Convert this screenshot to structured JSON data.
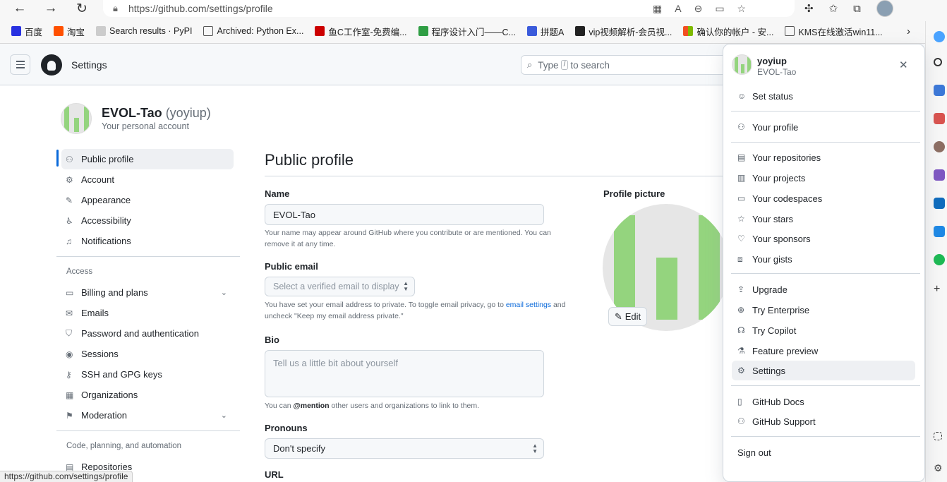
{
  "browser": {
    "url": "https://github.com/settings/profile",
    "bookmarks": [
      {
        "label": "百度",
        "color": "#2932e1"
      },
      {
        "label": "淘宝",
        "color": "#ff5000"
      },
      {
        "label": "Search results · PyPI",
        "color": "#cccccc"
      },
      {
        "label": "Archived: Python Ex...",
        "color": "#ffffff"
      },
      {
        "label": "鱼C工作室-免费编...",
        "color": "#cc0000"
      },
      {
        "label": "程序设计入门——C...",
        "color": "#2f9e44"
      },
      {
        "label": "拼题A",
        "color": "#3b5bdb"
      },
      {
        "label": "vip视频解析-会员视...",
        "color": "#222222"
      },
      {
        "label": "确认你的帐户 - 安...",
        "color": "#f25022"
      },
      {
        "label": "KMS在线激活win11...",
        "color": "#ffffff"
      }
    ]
  },
  "header": {
    "title": "Settings",
    "search_prefix": "Type",
    "search_key": "/",
    "search_suffix": "to search"
  },
  "account": {
    "display_name": "EVOL-Tao",
    "login": "(yoyiup)",
    "subtitle": "Your personal account"
  },
  "sidebar": {
    "items": [
      {
        "label": "Public profile",
        "icon": "person-icon"
      },
      {
        "label": "Account",
        "icon": "gear-icon"
      },
      {
        "label": "Appearance",
        "icon": "paintbrush-icon"
      },
      {
        "label": "Accessibility",
        "icon": "accessibility-icon"
      },
      {
        "label": "Notifications",
        "icon": "bell-icon"
      }
    ],
    "group_access": "Access",
    "access_items": [
      {
        "label": "Billing and plans",
        "icon": "credit-card-icon"
      },
      {
        "label": "Emails",
        "icon": "mail-icon"
      },
      {
        "label": "Password and authentication",
        "icon": "shield-lock-icon"
      },
      {
        "label": "Sessions",
        "icon": "broadcast-icon"
      },
      {
        "label": "SSH and GPG keys",
        "icon": "key-icon"
      },
      {
        "label": "Organizations",
        "icon": "organization-icon"
      },
      {
        "label": "Moderation",
        "icon": "report-icon"
      }
    ],
    "group_code": "Code, planning, and automation",
    "code_items": [
      {
        "label": "Repositories",
        "icon": "repo-icon"
      }
    ]
  },
  "main": {
    "title": "Public profile",
    "name_label": "Name",
    "name_value": "EVOL-Tao",
    "name_note": "Your name may appear around GitHub where you contribute or are mentioned. You can remove it at any time.",
    "email_label": "Public email",
    "email_placeholder": "Select a verified email to display",
    "email_note_1": "You have set your email address to private. To toggle email privacy, go to",
    "email_note_link": "email settings",
    "email_note_2": "and uncheck \"Keep my email address private.\"",
    "bio_label": "Bio",
    "bio_placeholder": "Tell us a little bit about yourself",
    "bio_note_1": "You can",
    "bio_note_mention": "@mention",
    "bio_note_2": "other users and organizations to link to them.",
    "pronouns_label": "Pronouns",
    "pronouns_value": "Don't specify",
    "url_label": "URL",
    "picture_label": "Profile picture",
    "edit_label": "Edit"
  },
  "menu": {
    "username": "yoyiup",
    "fullname": "EVOL-Tao",
    "items": [
      {
        "label": "Set status",
        "icon": "smiley-icon"
      },
      {
        "label": "Your profile",
        "icon": "person-icon"
      },
      {
        "label": "Your repositories",
        "icon": "repo-icon"
      },
      {
        "label": "Your projects",
        "icon": "table-icon"
      },
      {
        "label": "Your codespaces",
        "icon": "codespaces-icon"
      },
      {
        "label": "Your stars",
        "icon": "star-icon"
      },
      {
        "label": "Your sponsors",
        "icon": "heart-icon"
      },
      {
        "label": "Your gists",
        "icon": "code-square-icon"
      },
      {
        "label": "Upgrade",
        "icon": "upload-icon"
      },
      {
        "label": "Try Enterprise",
        "icon": "globe-icon"
      },
      {
        "label": "Try Copilot",
        "icon": "copilot-icon"
      },
      {
        "label": "Feature preview",
        "icon": "beaker-icon"
      },
      {
        "label": "Settings",
        "icon": "gear-icon"
      },
      {
        "label": "GitHub Docs",
        "icon": "book-icon"
      },
      {
        "label": "GitHub Support",
        "icon": "people-icon"
      },
      {
        "label": "Sign out",
        "icon": ""
      }
    ]
  },
  "status_bar": {
    "hover_url": "https://github.com/settings/profile"
  },
  "colors": {
    "accent": "#0969da",
    "avatar_green": "#94d47e"
  }
}
